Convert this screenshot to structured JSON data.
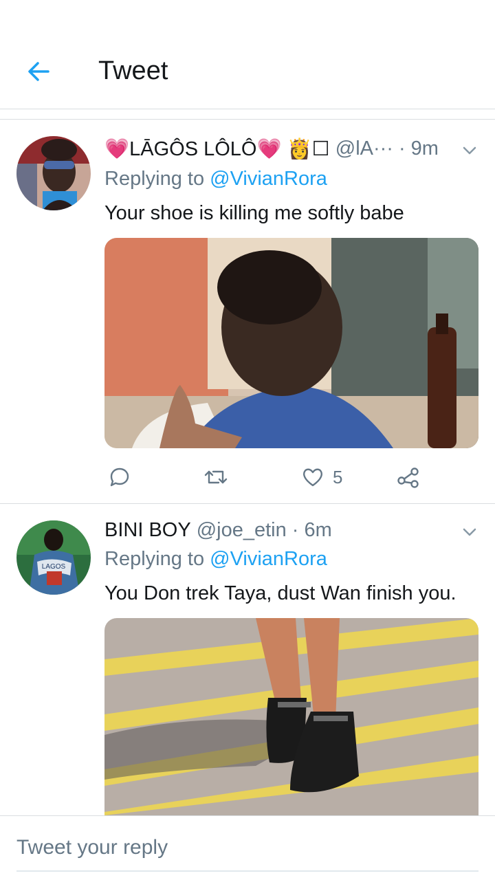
{
  "header": {
    "title": "Tweet",
    "back_icon": "arrow-left-icon",
    "accent": "#1da1f2"
  },
  "tweets": [
    {
      "name": "💗LĀGÔS LÔLÔ💗 👸☐",
      "handle": "@lA···",
      "time": "· 9m",
      "replying_prefix": "Replying to ",
      "replying_to": "@VivianRora",
      "text": "Your shoe is killing me softly babe",
      "actions": {
        "reply_icon": "reply-icon",
        "retweet_icon": "retweet-icon",
        "like_icon": "heart-icon",
        "like_count": "5",
        "share_icon": "share-icon"
      }
    },
    {
      "name": "BINI BOY",
      "handle": "@joe_etin",
      "time": "· 6m",
      "replying_prefix": "Replying to ",
      "replying_to": "@VivianRora",
      "text": "You Don trek Taya, dust Wan finish you.",
      "avatar_text": "LAGOS"
    }
  ],
  "compose": {
    "placeholder": "Tweet your reply"
  }
}
